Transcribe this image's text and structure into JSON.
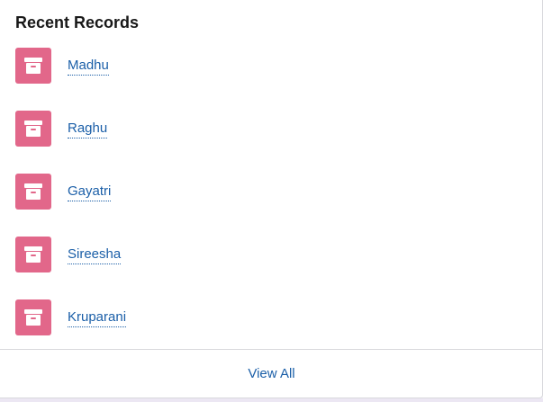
{
  "card": {
    "title": "Recent Records",
    "view_all_label": "View All"
  },
  "records": [
    {
      "name": "Madhu",
      "icon": "archive-box-icon"
    },
    {
      "name": "Raghu",
      "icon": "archive-box-icon"
    },
    {
      "name": "Gayatri",
      "icon": "archive-box-icon"
    },
    {
      "name": "Sireesha",
      "icon": "archive-box-icon"
    },
    {
      "name": "Kruparani",
      "icon": "archive-box-icon"
    }
  ],
  "colors": {
    "icon_background": "#e2678a",
    "link": "#1b5fa8",
    "title": "#181818"
  }
}
